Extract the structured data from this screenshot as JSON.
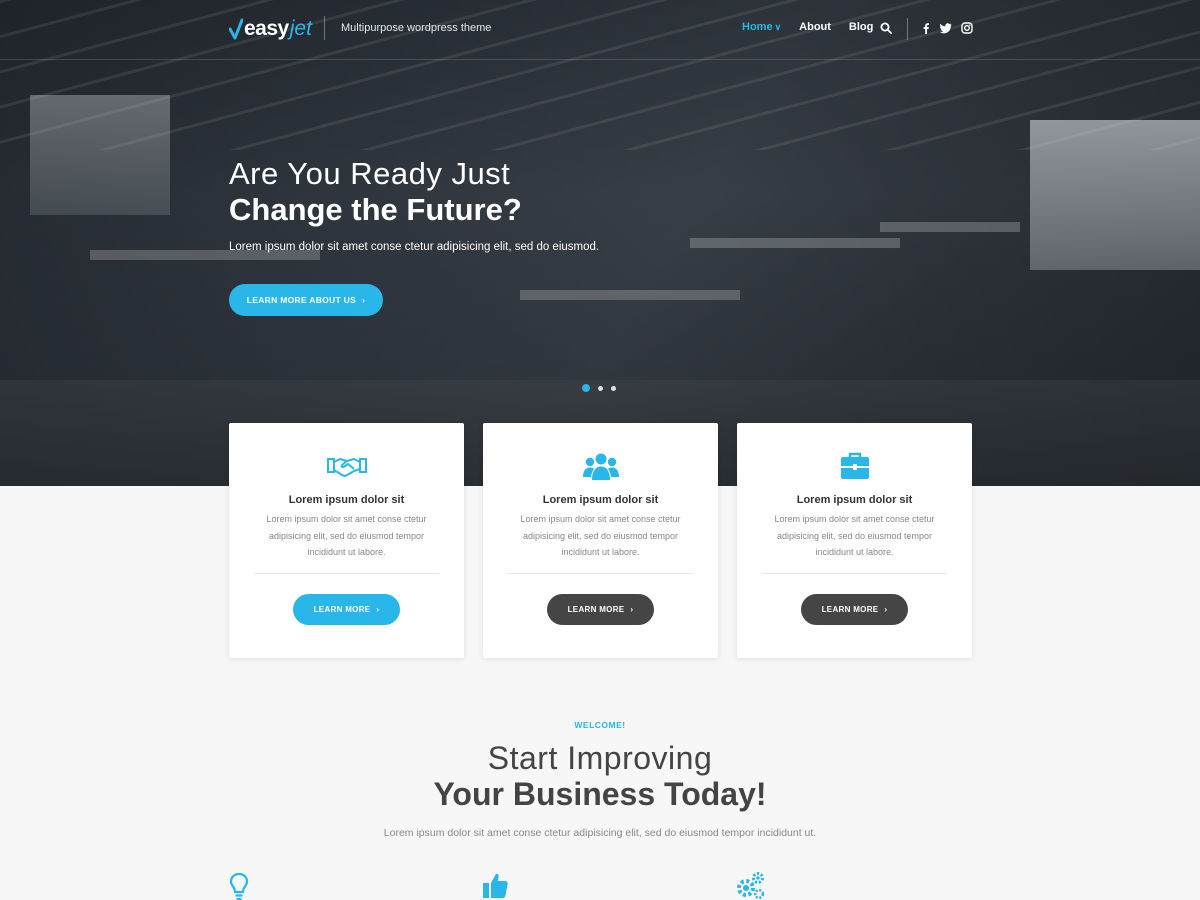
{
  "header": {
    "logo": {
      "easy": "easy",
      "jet": "jet"
    },
    "tagline": "Multipurpose wordpress theme",
    "nav": [
      {
        "label": "Home",
        "active": true
      },
      {
        "label": "About",
        "active": false
      },
      {
        "label": "Blog",
        "active": false
      }
    ],
    "icons": [
      "search-icon",
      "facebook-icon",
      "twitter-icon",
      "instagram-icon"
    ]
  },
  "hero": {
    "title_line1": "Are You Ready Just",
    "title_line2": "Change the Future?",
    "subtitle": "Lorem ipsum dolor sit amet conse ctetur adipisicing elit, sed do eiusmod.",
    "button_label": "LEARN MORE ABOUT US",
    "slides": {
      "count": 3,
      "active": 1
    }
  },
  "features": [
    {
      "icon": "handshake-icon",
      "title": "Lorem ipsum dolor sit",
      "text": "Lorem ipsum dolor sit amet conse ctetur adipisicing elit, sed do eiusmod tempor incididunt ut labore.",
      "button_label": "LEARN MORE",
      "button_style": "blue"
    },
    {
      "icon": "users-icon",
      "title": "Lorem ipsum dolor sit",
      "text": "Lorem ipsum dolor sit amet conse ctetur adipisicing elit, sed do eiusmod tempor incididunt ut labore.",
      "button_label": "LEARN MORE",
      "button_style": "dark"
    },
    {
      "icon": "briefcase-icon",
      "title": "Lorem ipsum dolor sit",
      "text": "Lorem ipsum dolor sit amet conse ctetur adipisicing elit, sed do eiusmod tempor incididunt ut labore.",
      "button_label": "LEARN MORE",
      "button_style": "dark"
    }
  ],
  "welcome": {
    "tag": "WELCOME!",
    "title_line1": "Start Improving",
    "title_line2": "Your Business Today!",
    "subtitle": "Lorem ipsum dolor sit amet conse ctetur adipisicing elit, sed do eiusmod tempor incididunt ut.",
    "icons": [
      "lightbulb-icon",
      "thumbs-up-icon",
      "gears-icon"
    ]
  },
  "colors": {
    "accent": "#29b6e8",
    "dark_button": "#454545",
    "page_bg": "#f7f7f7"
  }
}
